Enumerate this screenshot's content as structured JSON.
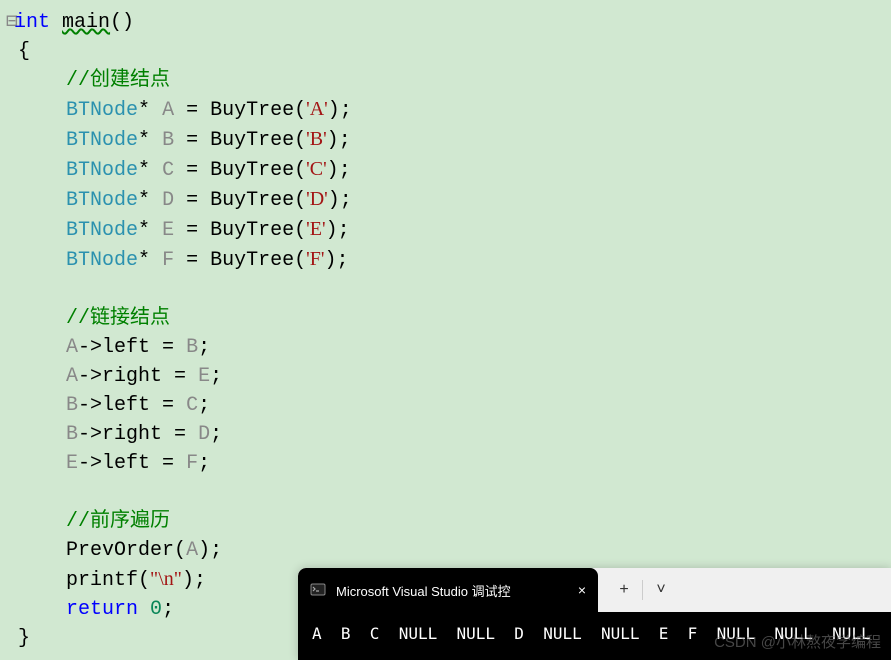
{
  "code": {
    "type_int": "int",
    "fn_main": "main",
    "parens": "()",
    "brace_open": "{",
    "brace_close": "}",
    "comment1": "//创建结点",
    "typename": "BTNode",
    "star": "*",
    "eq": " = ",
    "buytree": "BuyTree",
    "semi": ";",
    "vars": {
      "A": "A",
      "B": "B",
      "C": "C",
      "D": "D",
      "E": "E",
      "F": "F"
    },
    "chars": {
      "A": "'A'",
      "B": "'B'",
      "C": "'C'",
      "D": "'D'",
      "E": "'E'",
      "F": "'F'"
    },
    "comment2": "//链接结点",
    "links": {
      "l1": "A->left = B;",
      "l2": "A->right = E;",
      "l3": "B->left = C;",
      "l4": "B->right = D;",
      "l5": "E->left = F;"
    },
    "link_parts": {
      "A": "A",
      "B": "B",
      "C": "C",
      "D": "D",
      "E": "E",
      "F": "F",
      "arrow_left": "->left = ",
      "arrow_right": "->right = "
    },
    "comment3": "//前序遍历",
    "prevorder": "PrevOrder",
    "argA": "A",
    "printf": "printf",
    "newline_str": "\"\\n\"",
    "return": "return",
    "zero": "0"
  },
  "terminal": {
    "tab_title": "Microsoft Visual Studio 调试控",
    "plus_label": "+",
    "chevron_label": "˅",
    "close_label": "×",
    "output": "A  B  C  NULL  NULL  D  NULL  NULL  E  F  NULL  NULL  NULL"
  },
  "watermark": "CSDN @小林熬夜学编程"
}
